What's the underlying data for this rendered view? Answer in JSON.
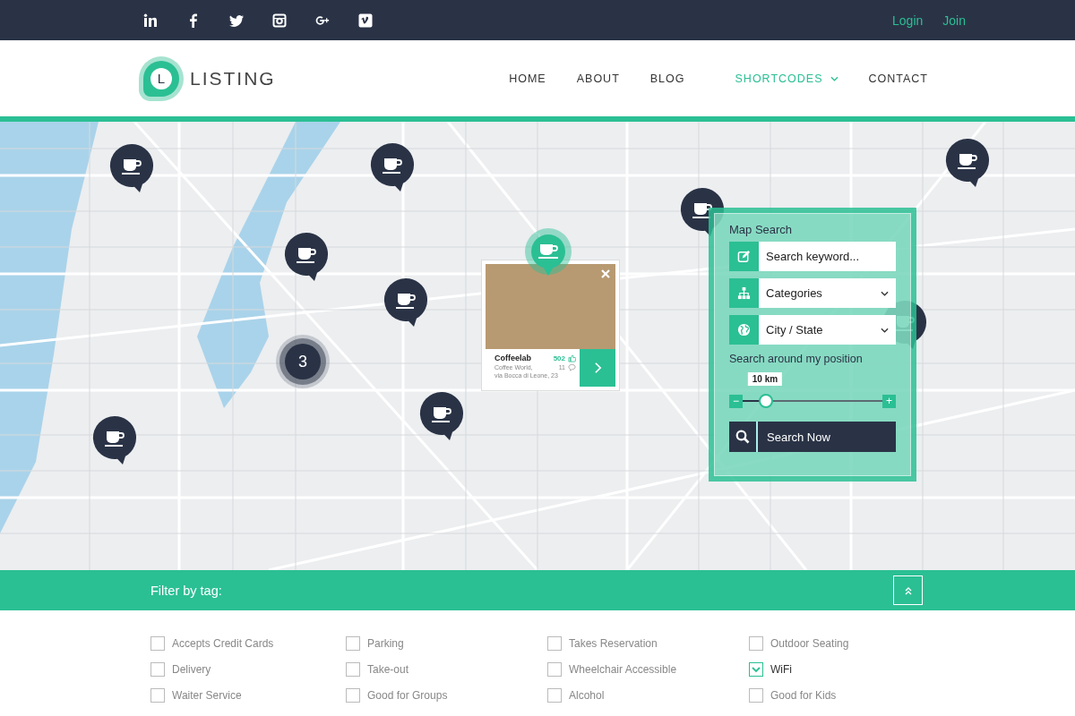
{
  "topbar": {
    "links": [
      "Login",
      "Join"
    ]
  },
  "header": {
    "logo_letter": "L",
    "logo_text": "LISTING",
    "nav": [
      {
        "label": "HOME",
        "selected": false,
        "dropdown": false
      },
      {
        "label": "ABOUT",
        "selected": false,
        "dropdown": false
      },
      {
        "label": "BLOG",
        "selected": false,
        "dropdown": false
      },
      {
        "label": "SHORTCODES",
        "selected": true,
        "dropdown": true
      },
      {
        "label": "CONTACT",
        "selected": false,
        "dropdown": false
      }
    ]
  },
  "map": {
    "cluster_count": "3",
    "popup": {
      "name": "Coffeelab",
      "likes": "502",
      "comments": "11",
      "address_line_1": "Coffee World,",
      "address_line_2": "via Bocca di Leone, 23"
    },
    "search": {
      "title": "Map Search",
      "keyword_placeholder": "Search keyword...",
      "category": "Categories",
      "location": "City / State",
      "radius_label": "Search around my position",
      "radius_value": "10 km",
      "radius": {
        "level": 0.16
      },
      "minus": "−",
      "plus": "+",
      "button": "Search Now"
    }
  },
  "filter": {
    "title": "Filter by tag:",
    "tags": [
      {
        "label": "Accepts Credit Cards",
        "checked": false
      },
      {
        "label": "Parking",
        "checked": false
      },
      {
        "label": "Takes Reservation",
        "checked": false
      },
      {
        "label": "Outdoor Seating",
        "checked": false
      },
      {
        "label": "Delivery",
        "checked": false
      },
      {
        "label": "Take-out",
        "checked": false
      },
      {
        "label": "Wheelchair Accessible",
        "checked": false
      },
      {
        "label": "WiFi",
        "checked": true
      },
      {
        "label": "Waiter Service",
        "checked": false
      },
      {
        "label": "Good for Groups",
        "checked": false
      },
      {
        "label": "Alcohol",
        "checked": false
      },
      {
        "label": "Good for Kids",
        "checked": false
      }
    ]
  }
}
